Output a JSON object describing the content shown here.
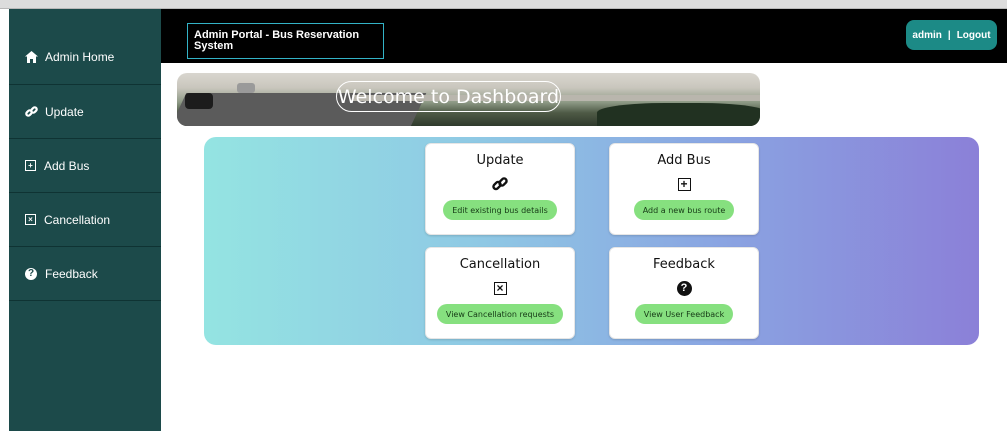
{
  "header": {
    "title": "Admin Portal - Bus Reservation System",
    "user": "admin",
    "separator": "|",
    "logout": "Logout"
  },
  "sidebar": {
    "items": [
      {
        "label": "Admin Home",
        "icon": "home-icon"
      },
      {
        "label": "Update",
        "icon": "link-icon"
      },
      {
        "label": "Add Bus",
        "icon": "plus-square-icon"
      },
      {
        "label": "Cancellation",
        "icon": "x-square-icon"
      },
      {
        "label": "Feedback",
        "icon": "question-circle-icon"
      }
    ]
  },
  "banner": {
    "text": "Welcome to Dashboard"
  },
  "cards": [
    {
      "title": "Update",
      "icon": "link-icon",
      "button": "Edit existing bus details"
    },
    {
      "title": "Add Bus",
      "icon": "plus-square-icon",
      "button": "Add a new bus route"
    },
    {
      "title": "Cancellation",
      "icon": "x-square-icon",
      "button": "View Cancellation requests"
    },
    {
      "title": "Feedback",
      "icon": "question-circle-icon",
      "button": "View User Feedback"
    }
  ],
  "colors": {
    "sidebar": "#1c4a4a",
    "header": "#000000",
    "accent": "#1c8a86",
    "button": "#86e07f"
  }
}
